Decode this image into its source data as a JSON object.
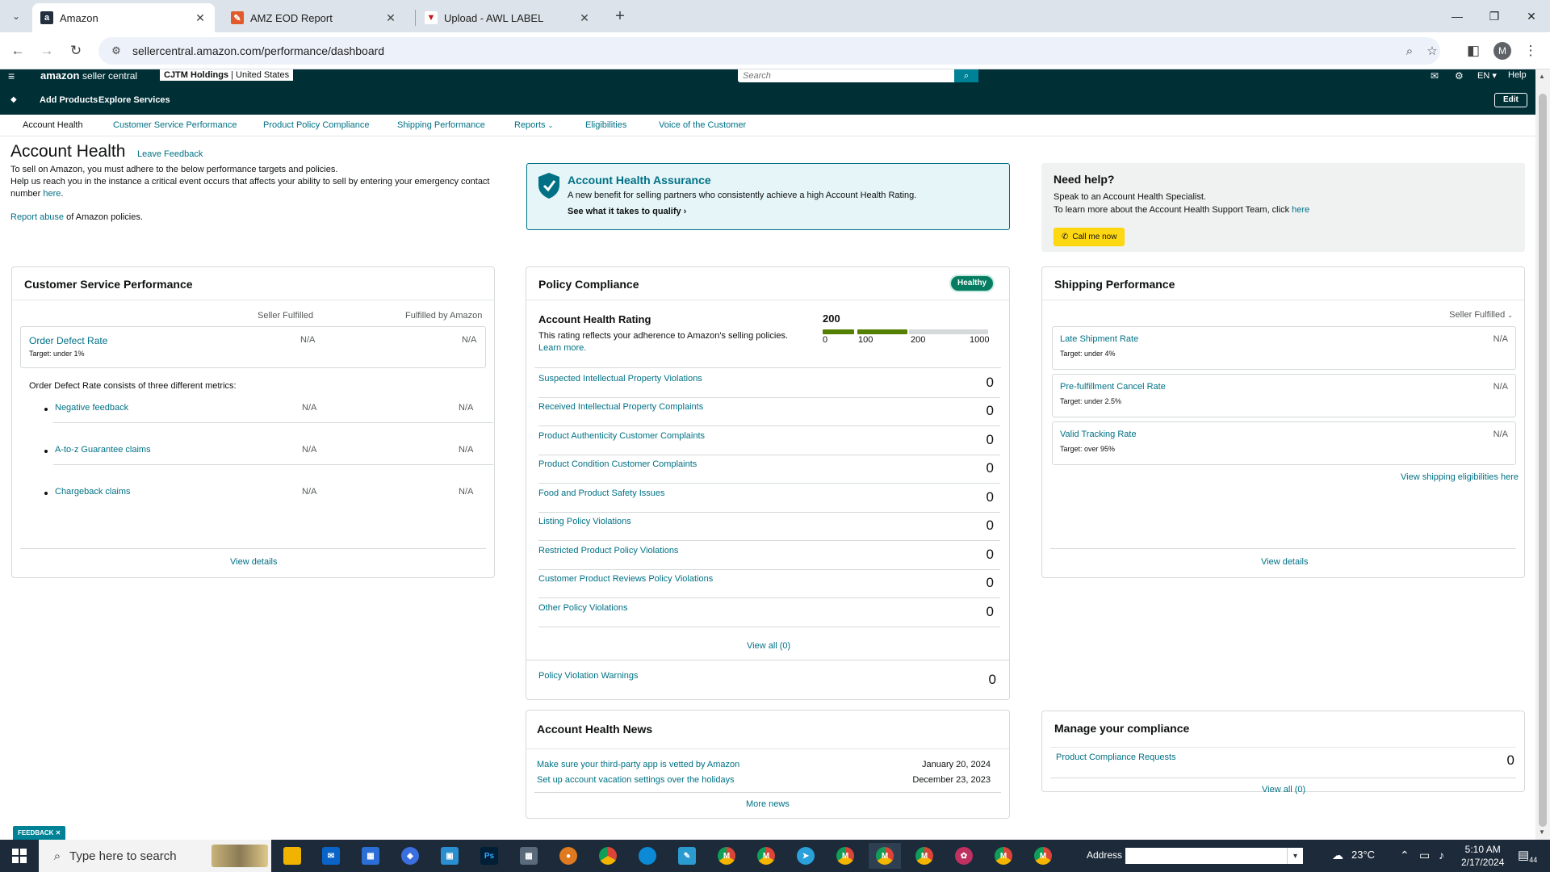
{
  "browser": {
    "tabs": [
      {
        "title": "Amazon",
        "favicon": "a",
        "favicon_color": "#232f3e",
        "active": true
      },
      {
        "title": "AMZ EOD Report",
        "favicon": "✎",
        "favicon_color": "#e05a2b",
        "active": false
      },
      {
        "title": "Upload - AWL LABEL",
        "favicon": "▼",
        "favicon_color": "#c4161c",
        "active": false
      }
    ],
    "url": "sellercentral.amazon.com/performance/dashboard",
    "profile_initial": "M"
  },
  "sc_header": {
    "logo_main": "amazon",
    "logo_sub": "seller central",
    "account_bold": "CJTM Holdings",
    "account_region": "United States",
    "search_placeholder": "Search",
    "lang": "EN",
    "help": "Help",
    "bar_links": [
      "Add Products",
      "Explore Services"
    ],
    "edit": "Edit"
  },
  "subnav": [
    "Account Health",
    "Customer Service Performance",
    "Product Policy Compliance",
    "Shipping Performance",
    "Reports",
    "Eligibilities",
    "Voice of the Customer"
  ],
  "intro": {
    "title": "Account Health",
    "leave_feedback": "Leave Feedback",
    "line1": "To sell on Amazon, you must adhere to the below performance targets and policies.",
    "line2": "Help us reach you in the instance a critical event occurs that affects your ability to sell by entering your emergency contact number",
    "line2_link": "here",
    "report_link": "Report abuse",
    "report_rest": "of Amazon policies."
  },
  "assurance": {
    "title": "Account Health Assurance",
    "desc": "A new benefit for selling partners who consistently achieve a high Account Health Rating.",
    "link": "See what it takes to qualify"
  },
  "need_help": {
    "title": "Need help?",
    "line1": "Speak to an Account Health Specialist.",
    "line2": "To learn more about the Account Health Support Team, click",
    "line2_link": "here",
    "call_button": "Call me now"
  },
  "customer_service": {
    "title": "Customer Service Performance",
    "col1": "Seller Fulfilled",
    "col2": "Fulfilled by Amazon",
    "odr_name": "Order Defect Rate",
    "odr_target": "Target: under 1%",
    "odr_sf": "N/A",
    "odr_fba": "N/A",
    "note": "Order Defect Rate consists of three different metrics:",
    "metrics": [
      {
        "name": "Negative feedback",
        "sf": "N/A",
        "fba": "N/A"
      },
      {
        "name": "A-to-z Guarantee claims",
        "sf": "N/A",
        "fba": "N/A"
      },
      {
        "name": "Chargeback claims",
        "sf": "N/A",
        "fba": "N/A"
      }
    ],
    "view_details": "View details"
  },
  "policy": {
    "title": "Policy Compliance",
    "status": "Healthy",
    "ahr_title": "Account Health Rating",
    "ahr_desc": "This rating reflects your adherence to Amazon's selling policies.",
    "learn_more": "Learn more.",
    "score": "200",
    "score_value": 200,
    "ticks": [
      "0",
      "100",
      "200",
      "1000"
    ],
    "violations": [
      {
        "name": "Suspected Intellectual Property Violations",
        "count": "0"
      },
      {
        "name": "Received Intellectual Property Complaints",
        "count": "0"
      },
      {
        "name": "Product Authenticity Customer Complaints",
        "count": "0"
      },
      {
        "name": "Product Condition Customer Complaints",
        "count": "0"
      },
      {
        "name": "Food and Product Safety Issues",
        "count": "0"
      },
      {
        "name": "Listing Policy Violations",
        "count": "0"
      },
      {
        "name": "Restricted Product Policy Violations",
        "count": "0"
      },
      {
        "name": "Customer Product Reviews Policy Violations",
        "count": "0"
      },
      {
        "name": "Other Policy Violations",
        "count": "0"
      }
    ],
    "view_all": "View all (0)",
    "warnings_name": "Policy Violation Warnings",
    "warnings_count": "0",
    "colors": {
      "green": "#538000",
      "gray": "#d5d9d9"
    }
  },
  "news": {
    "title": "Account Health News",
    "items": [
      {
        "text": "Make sure your third-party app is vetted by Amazon",
        "date": "January 20, 2024"
      },
      {
        "text": "Set up account vacation settings over the holidays",
        "date": "December 23, 2023"
      }
    ],
    "more": "More news"
  },
  "shipping": {
    "title": "Shipping Performance",
    "filter": "Seller Fulfilled",
    "metrics": [
      {
        "name": "Late Shipment Rate",
        "target": "Target: under 4%",
        "value": "N/A"
      },
      {
        "name": "Pre-fulfillment Cancel Rate",
        "target": "Target: under 2.5%",
        "value": "N/A"
      },
      {
        "name": "Valid Tracking Rate",
        "target": "Target: over 95%",
        "value": "N/A"
      }
    ],
    "eligibilities": "View shipping eligibilities here",
    "view_details": "View details"
  },
  "compliance": {
    "title": "Manage your compliance",
    "row": "Product Compliance Requests",
    "count": "0",
    "view_all": "View all (0)"
  },
  "feedback_tab": "FEEDBACK ✕",
  "taskbar": {
    "search_placeholder": "Type here to search",
    "address_label": "Address",
    "temperature": "23°C",
    "time": "5:10 AM",
    "date": "2/17/2024",
    "notifications": "44"
  }
}
